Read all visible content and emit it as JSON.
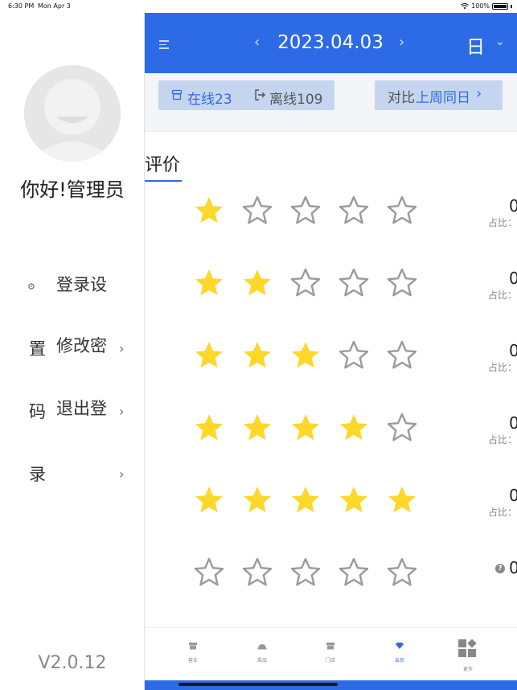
{
  "status_bar": {
    "time": "6:30 PM",
    "date": "Mon Apr 3",
    "battery": "100%"
  },
  "sidebar": {
    "greeting": "你好!管理员",
    "menu": [
      {
        "label": "登录设",
        "icon": "gear-icon"
      },
      {
        "label": "修改密",
        "icon": "lock-icon"
      },
      {
        "label": "退出登",
        "icon": "logout-icon"
      }
    ],
    "wrapped_text": [
      "置",
      "码",
      "录"
    ],
    "version": "V2.0.12"
  },
  "header": {
    "date": "2023.04.03",
    "period": "日",
    "prev_label": "‹",
    "next_label": "›"
  },
  "filters": {
    "online": "在线23",
    "offline": "离线109",
    "compare_prefix": "对比",
    "compare_value": "上周同日"
  },
  "section": {
    "title": "评价"
  },
  "ratings": [
    {
      "stars": 1,
      "value": "0",
      "ratio": "占比："
    },
    {
      "stars": 2,
      "value": "0",
      "ratio": "占比："
    },
    {
      "stars": 3,
      "value": "0",
      "ratio": "占比："
    },
    {
      "stars": 4,
      "value": "0",
      "ratio": "占比："
    },
    {
      "stars": 5,
      "value": "0",
      "ratio": "占比："
    },
    {
      "stars": 0,
      "value": "0",
      "ratio": ""
    }
  ],
  "bottom_nav": {
    "tabs": [
      {
        "label": "营业",
        "icon": "store-icon"
      },
      {
        "label": "菜品",
        "icon": "dish-icon"
      },
      {
        "label": "门店",
        "icon": "shop-icon"
      },
      {
        "label": "会员",
        "icon": "diamond-icon",
        "active": true
      }
    ],
    "more_label": "更多"
  },
  "colors": {
    "primary": "#2d6ae5",
    "star_filled": "#fdd72a",
    "star_empty": "#9a9a9a",
    "pill_bg": "#c6d5ef"
  }
}
